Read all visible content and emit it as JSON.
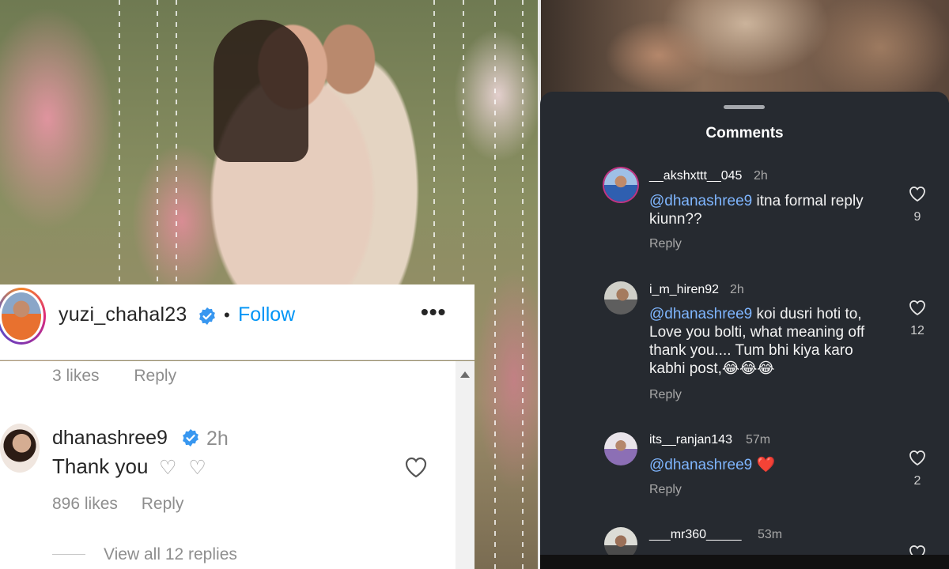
{
  "post": {
    "username": "yuzi_chahal23",
    "separator": "•",
    "follow_label": "Follow",
    "more_label": "•••",
    "previous_comment_meta": {
      "likes": "3 likes",
      "reply": "Reply"
    }
  },
  "featured_comment": {
    "username": "dhanashree9",
    "time": "2h",
    "text": "Thank you",
    "hearts": "♡ ♡",
    "likes": "896 likes",
    "reply": "Reply",
    "view_replies": "View all 12 replies"
  },
  "sheet": {
    "title": "Comments",
    "comments": [
      {
        "username": "__akshxttt__045",
        "time": "2h",
        "mention": "@dhanashree9",
        "text": " itna formal reply kiunn??",
        "reply": "Reply",
        "likes": "9"
      },
      {
        "username": "i_m_hiren92",
        "time": "2h",
        "mention": "@dhanashree9",
        "text": " koi dusri hoti to, Love you bolti, what meaning off thank you.... Tum bhi kiya karo kabhi post,😂😂😂",
        "reply": "Reply",
        "likes": "12"
      },
      {
        "username": "its__ranjan143",
        "time": "57m",
        "mention": "@dhanashree9",
        "text": " ❤️",
        "reply": "Reply",
        "likes": "2"
      },
      {
        "username": "___mr360_____",
        "time": "53m"
      }
    ]
  },
  "colors": {
    "link_blue": "#0095f6",
    "mention_blue": "#7fb6ff",
    "sheet_bg": "#262a30",
    "heart_red": "#e0245e"
  }
}
